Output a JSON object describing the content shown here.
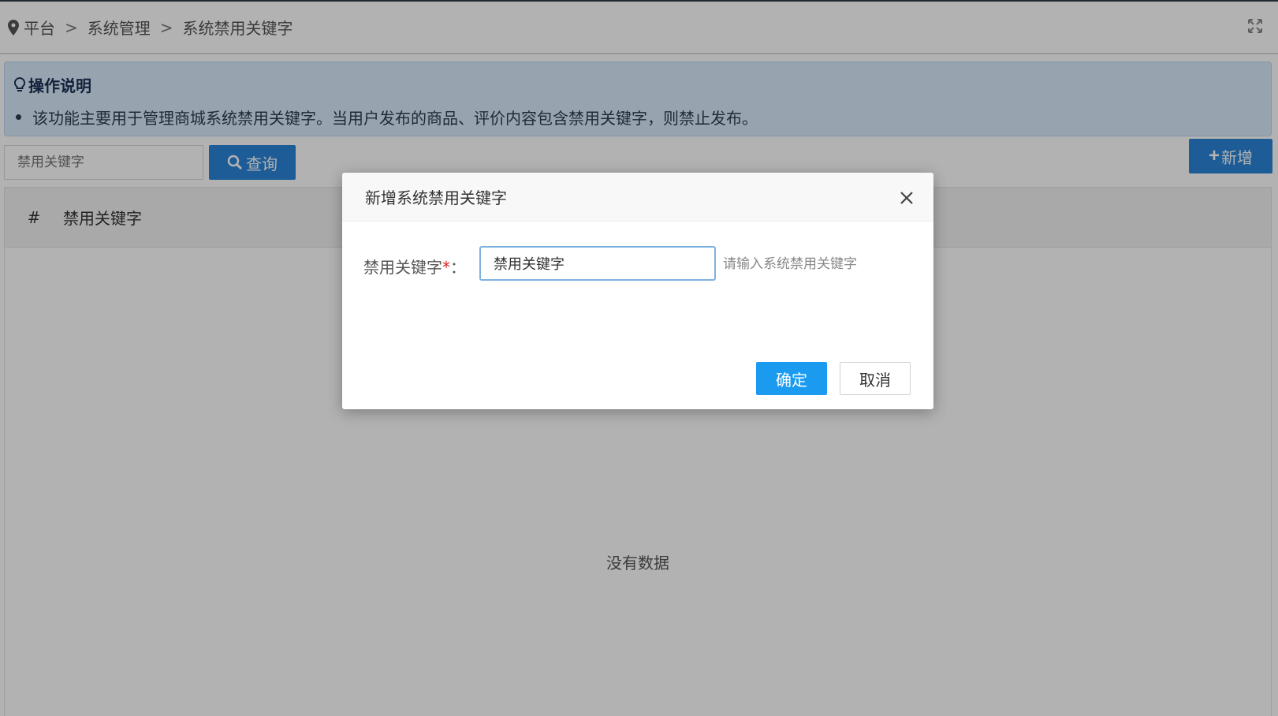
{
  "breadcrumb": {
    "items": [
      "平台",
      "系统管理",
      "系统禁用关键字"
    ],
    "separator": ">"
  },
  "notice": {
    "title": "操作说明",
    "text": "该功能主要用于管理商城系统禁用关键字。当用户发布的商品、评价内容包含禁用关键字，则禁止发布。"
  },
  "toolbar": {
    "search_placeholder": "禁用关键字",
    "search_label": "查询",
    "add_label": "新增"
  },
  "table": {
    "columns": [
      "#",
      "禁用关键字"
    ],
    "empty_text": "没有数据"
  },
  "modal": {
    "title": "新增系统禁用关键字",
    "field_label": "禁用关键字",
    "required_mark": "*",
    "label_colon": "：",
    "field_value": "禁用关键字",
    "field_hint": "请输入系统禁用关键字",
    "confirm_label": "确定",
    "cancel_label": "取消"
  },
  "colors": {
    "primary": "#2a84d8",
    "confirm": "#1b9bf0",
    "required": "#e02020",
    "notice_bg": "#d9ebfb"
  },
  "icons": {
    "breadcrumb": "map-pin-icon",
    "expand": "expand-icon",
    "notice": "lightbulb-icon",
    "search": "search-icon",
    "add": "plus-icon",
    "close": "close-icon"
  }
}
